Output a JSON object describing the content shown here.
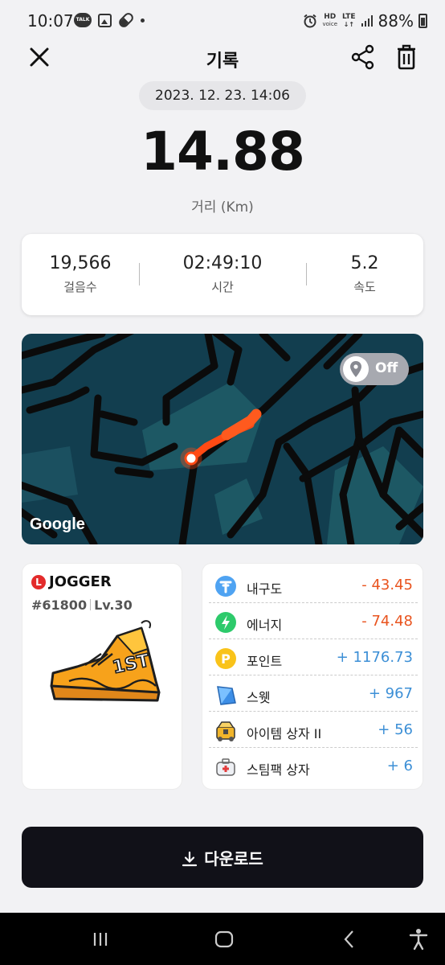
{
  "status_bar": {
    "time": "10:07",
    "talk_label": "TALK",
    "hd_label": "HD",
    "voice_label": "voice",
    "lte_label": "LTE",
    "battery": "88%"
  },
  "header": {
    "title": "기록"
  },
  "record": {
    "datetime": "2023. 12. 23. 14:06",
    "distance": "14.88",
    "distance_label": "거리 (Km)"
  },
  "stats": [
    {
      "value": "19,566",
      "label": "걸음수"
    },
    {
      "value": "02:49:10",
      "label": "시간"
    },
    {
      "value": "5.2",
      "label": "속도"
    }
  ],
  "map": {
    "toggle_label": "Off",
    "google_label": "Google"
  },
  "jogger": {
    "badge": "L",
    "name": "JOGGER",
    "id": "#61800",
    "level": "Lv.30"
  },
  "rewards": [
    {
      "name": "내구도",
      "value": "- 43.45",
      "icon": "durability-icon"
    },
    {
      "name": "에너지",
      "value": "- 74.48",
      "icon": "energy-icon"
    },
    {
      "name": "포인트",
      "value": "+ 1176.73",
      "icon": "point-icon"
    },
    {
      "name": "스웻",
      "value": "+ 967",
      "icon": "sweat-icon"
    },
    {
      "name": "아이템 상자 II",
      "value": "+ 56",
      "icon": "item-box-icon"
    },
    {
      "name": "스팀팩 상자",
      "value": "+ 6",
      "icon": "steampack-box-icon"
    }
  ],
  "download": {
    "label": "다운로드"
  },
  "colors": {
    "negative": "#e9541f",
    "positive": "#3c8fd6",
    "route": "#ff4a14",
    "map_bg": "#123e4f"
  }
}
